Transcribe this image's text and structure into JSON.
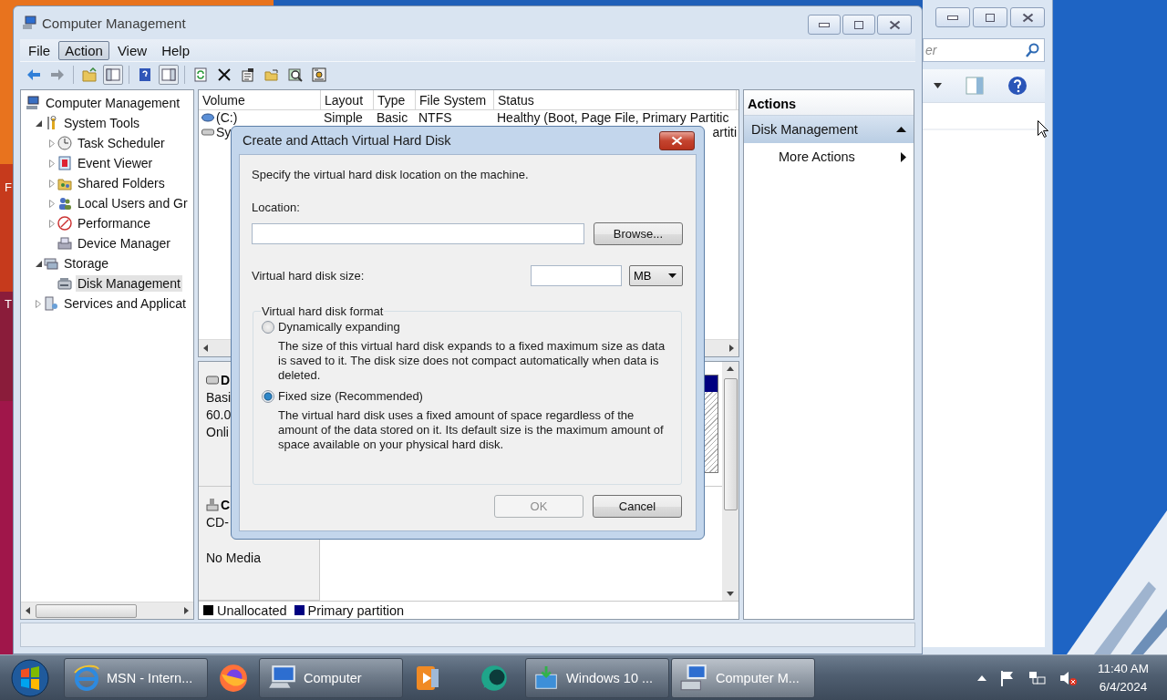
{
  "desktop": {
    "icon_labels": [
      "F",
      "T"
    ]
  },
  "back_window": {
    "search": {
      "placeholder": "er"
    }
  },
  "main_window": {
    "title": "Computer Management",
    "menu": [
      {
        "label": "File",
        "selected": false
      },
      {
        "label": "Action",
        "selected": true
      },
      {
        "label": "View",
        "selected": false
      },
      {
        "label": "Help",
        "selected": false
      }
    ],
    "toolbar": [
      [
        {
          "kind": "back",
          "pressed": false
        },
        {
          "kind": "forward",
          "pressed": false
        }
      ],
      [
        {
          "kind": "up",
          "pressed": false
        },
        {
          "kind": "tree",
          "pressed": true
        }
      ],
      [
        {
          "kind": "help",
          "pressed": false
        },
        {
          "kind": "pane",
          "pressed": true
        }
      ],
      [
        {
          "kind": "refresh",
          "pressed": false
        },
        {
          "kind": "delete",
          "pressed": false
        },
        {
          "kind": "properties",
          "pressed": false
        },
        {
          "kind": "open",
          "pressed": false
        },
        {
          "kind": "find",
          "pressed": false
        },
        {
          "kind": "settings",
          "pressed": false
        }
      ]
    ],
    "tree": [
      {
        "label": "Computer Management",
        "kind": "computer",
        "selected": false,
        "children": [
          {
            "label": "System Tools",
            "kind": "tools",
            "selected": false,
            "expanded": true,
            "children": [
              {
                "label": "Task Scheduler",
                "kind": "clock",
                "selected": false,
                "expanded": false
              },
              {
                "label": "Event Viewer",
                "kind": "event",
                "selected": false,
                "expanded": false
              },
              {
                "label": "Shared Folders",
                "kind": "share",
                "selected": false,
                "expanded": false
              },
              {
                "label": "Local Users and Gr",
                "kind": "users",
                "selected": false,
                "expanded": false
              },
              {
                "label": "Performance",
                "kind": "performance",
                "selected": false,
                "expanded": false
              },
              {
                "label": "Device Manager",
                "kind": "device",
                "selected": false
              }
            ]
          },
          {
            "label": "Storage",
            "kind": "storage",
            "selected": false,
            "expanded": true,
            "children": [
              {
                "label": "Disk Management",
                "kind": "disk",
                "selected": true
              }
            ]
          },
          {
            "label": "Services and Applicat",
            "kind": "services",
            "selected": false,
            "expanded": false
          }
        ]
      }
    ],
    "volume_table": {
      "columns": [
        "Volume",
        "Layout",
        "Type",
        "File System",
        "Status"
      ],
      "rows": [
        {
          "kind": "volume",
          "cells": [
            "(C:)",
            "Simple",
            "Basic",
            "NTFS",
            "Healthy (Boot, Page File, Primary Partitic"
          ]
        },
        {
          "kind": "drive",
          "cells": [
            "Sy",
            null,
            null,
            null,
            "artiti"
          ]
        }
      ]
    },
    "disks": [
      {
        "kind": "hard-disk",
        "name": "D",
        "lines": [
          "Basi",
          "60.0",
          "Onli"
        ]
      },
      {
        "kind": "cd",
        "name": "C",
        "lines": [
          "CD-"
        ],
        "media": "No Media"
      }
    ],
    "legend": [
      {
        "label": "Unallocated",
        "color": "#000000"
      },
      {
        "label": "Primary partition",
        "color": "#000080"
      }
    ],
    "actions": {
      "title": "Actions",
      "sections": [
        {
          "label": "Disk Management",
          "expanded": true,
          "items": [
            {
              "label": "More Actions",
              "kind": "submenu"
            }
          ]
        }
      ]
    }
  },
  "dialog": {
    "title": "Create and Attach Virtual Hard Disk",
    "intro": "Specify the virtual hard disk location on the machine.",
    "location_label": "Location:",
    "browse": "Browse...",
    "size_label": "Virtual hard disk size:",
    "unit": "MB",
    "format_title": "Virtual hard disk format",
    "options": [
      {
        "label": "Dynamically expanding",
        "selected": false,
        "description": "The size of this virtual hard disk expands to a fixed maximum size as data is saved to it.  The disk size does not compact automatically when data is deleted."
      },
      {
        "label": "Fixed size (Recommended)",
        "selected": true,
        "description": "The virtual hard disk uses a fixed amount of space regardless of the amount of the data stored on it. Its default size is the maximum amount of space available on your physical hard disk."
      }
    ],
    "buttons": [
      {
        "label": "OK",
        "disabled": true
      },
      {
        "label": "Cancel",
        "disabled": false
      }
    ]
  },
  "taskbar": {
    "items": [
      {
        "kind": "ie",
        "label": "MSN - Intern...",
        "open": true,
        "selected": false
      },
      {
        "kind": "firefox",
        "open": false,
        "selected": false
      },
      {
        "kind": "computer",
        "label": "Computer",
        "open": true,
        "selected": false
      },
      {
        "kind": "media",
        "open": false,
        "selected": false
      },
      {
        "kind": "chat",
        "open": false,
        "selected": false
      },
      {
        "kind": "installer",
        "label": "Windows 10 ...",
        "open": true,
        "selected": false
      },
      {
        "kind": "management",
        "label": "Computer M...",
        "open": true,
        "selected": true
      }
    ],
    "clock": {
      "time": "11:40 AM",
      "date": "6/4/2024"
    }
  }
}
